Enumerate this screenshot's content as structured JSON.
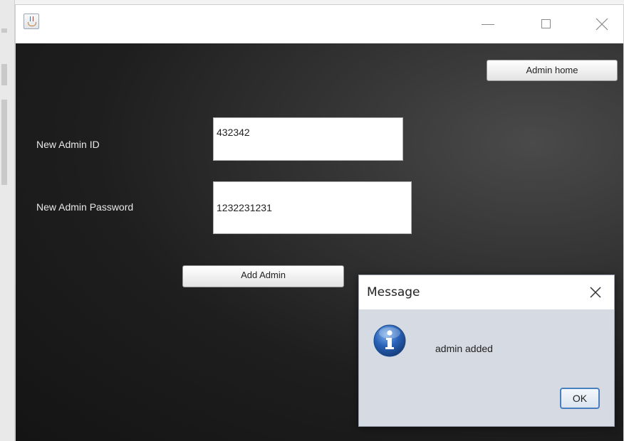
{
  "window": {
    "title": "",
    "controls": {
      "minimize_icon": "minimize-icon",
      "maximize_icon": "maximize-icon",
      "close_icon": "close-icon"
    }
  },
  "form": {
    "admin_home_label": "Admin home",
    "admin_id_label": "New Admin ID",
    "admin_id_value": "432342",
    "admin_password_label": "New Admin Password",
    "admin_password_value": "1232231231",
    "add_admin_label": "Add Admin"
  },
  "dialog": {
    "title": "Message",
    "message": "admin added",
    "ok_label": "OK",
    "icon": "info-icon"
  },
  "colors": {
    "background_dark": "#141414",
    "dialog_bg": "#d6dae3",
    "info_blue": "#2a62b8"
  }
}
